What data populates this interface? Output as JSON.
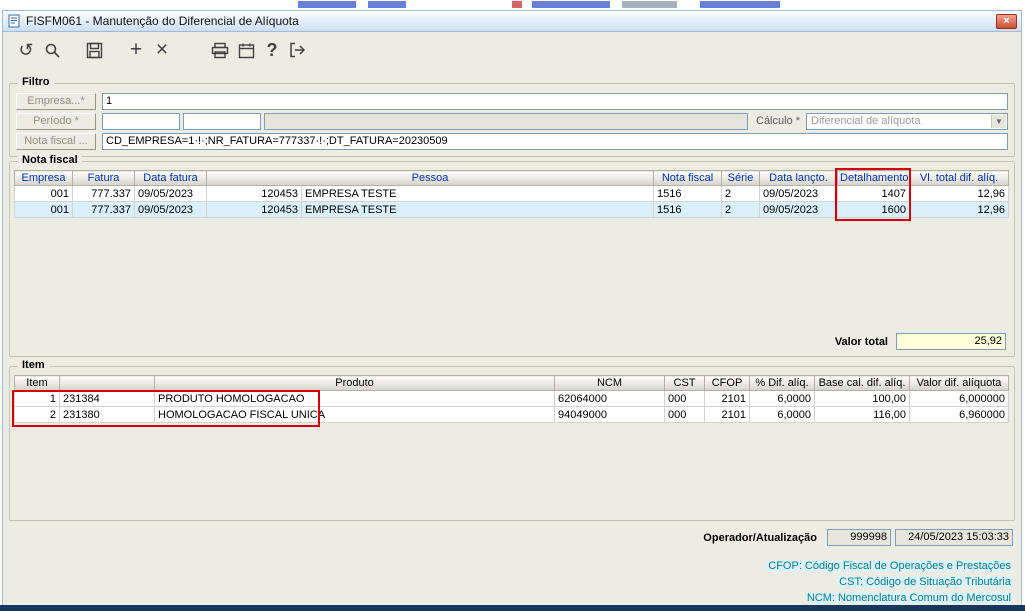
{
  "window": {
    "title": "FISFM061 - Manutenção do Diferencial de Alíquota",
    "close_label": "×"
  },
  "toolbar": {
    "icons": [
      "undo-icon",
      "search-icon",
      "save-icon",
      "add-icon",
      "delete-icon",
      "print-icon",
      "calendar-icon",
      "help-icon",
      "exit-icon"
    ],
    "undo_glyph": "↺",
    "add_glyph": "+",
    "delete_glyph": "×",
    "help_glyph": "?"
  },
  "filtro": {
    "legend": "Filtro",
    "empresa_button": "Empresa...*",
    "empresa_value": "1",
    "periodo_button": "Período *",
    "calculo_label": "Cálculo *",
    "calculo_value": "Diferencial de alíquota",
    "nota_fiscal_button": "Nota fiscal ...",
    "nota_fiscal_value": "CD_EMPRESA=1·!·;NR_FATURA=777337·!·;DT_FATURA=20230509"
  },
  "nota_fiscal": {
    "legend": "Nota fiscal",
    "headers": [
      "Empresa",
      "Fatura",
      "Data fatura",
      "Pessoa",
      "Nota fiscal",
      "Série",
      "Data lançto.",
      "Detalhamento",
      "Vl. total dif. alíq."
    ],
    "rows": [
      {
        "empresa": "001",
        "fatura": "777.337",
        "data_fatura": "09/05/2023",
        "pessoa_codigo": "120453",
        "pessoa_nome": "EMPRESA TESTE",
        "nota_fiscal": "1516",
        "serie": "2",
        "data_lancto": "09/05/2023",
        "detalhamento": "1407",
        "vl_total": "12,96"
      },
      {
        "empresa": "001",
        "fatura": "777.337",
        "data_fatura": "09/05/2023",
        "pessoa_codigo": "120453",
        "pessoa_nome": "EMPRESA TESTE",
        "nota_fiscal": "1516",
        "serie": "2",
        "data_lancto": "09/05/2023",
        "detalhamento": "1600",
        "vl_total": "12,96"
      }
    ],
    "valor_total_label": "Valor total",
    "valor_total": "25,92"
  },
  "item": {
    "legend": "Item",
    "headers": [
      "Item",
      "",
      "Produto",
      "NCM",
      "CST",
      "CFOP",
      "% Dif. alíq.",
      "Base cal. dif. alíq.",
      "Valor dif. alíquota"
    ],
    "rows": [
      {
        "item": "1",
        "codigo": "231384",
        "produto": "PRODUTO HOMOLOGACAO",
        "ncm": "62064000",
        "cst": "000",
        "cfop": "2101",
        "perc_dif": "6,0000",
        "base_calc": "100,00",
        "valor_dif": "6,000000"
      },
      {
        "item": "2",
        "codigo": "231380",
        "produto": "HOMOLOGACAO FISCAL UNICA",
        "ncm": "94049000",
        "cst": "000",
        "cfop": "2101",
        "perc_dif": "6,0000",
        "base_calc": "116,00",
        "valor_dif": "6,960000"
      }
    ]
  },
  "footer": {
    "operador_label": "Operador/Atualização",
    "operador_value": "999998",
    "atualizacao": "24/05/2023 15:03:33"
  },
  "notes": [
    "CFOP: Código Fiscal de Operações e Prestações",
    "CST: Código de Situação Tributária",
    "NCM: Nomenclatura Comum do Mercosul"
  ],
  "colors": {
    "highlight_red": "#d60000",
    "header_text_blue": "#0031b0",
    "selected_row": "#d9f0fa",
    "valor_total_bg": "#ffffd9",
    "notes_teal": "#00808c"
  }
}
